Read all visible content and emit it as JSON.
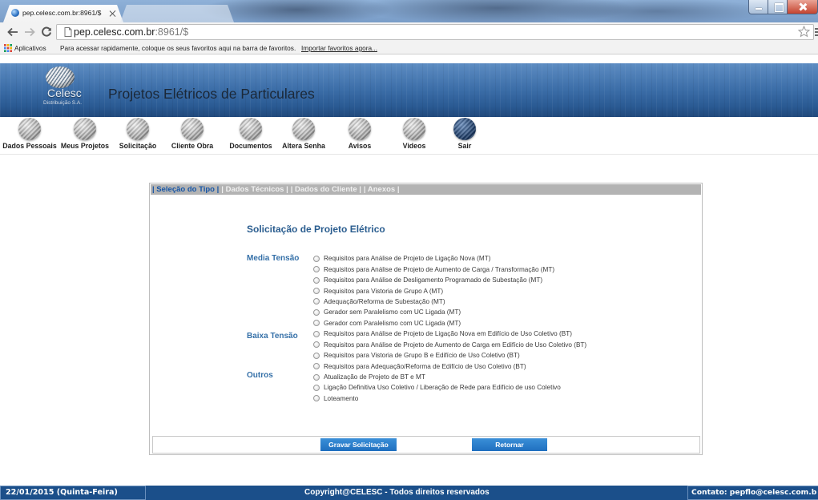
{
  "browser": {
    "active_tab": {
      "title": "pep.celesc.com.br:8961/$"
    },
    "address_bar": {
      "host": "pep.celesc.com.br",
      "rest": ":8961/$"
    },
    "bookmarks_bar": {
      "apps_label": "Aplicativos",
      "hint": "Para acessar rapidamente, coloque os seus favoritos aqui na barra de favoritos.",
      "import_link": "Importar favoritos agora..."
    },
    "icons": [
      "tab-close-icon",
      "minimize-icon",
      "maximize-icon",
      "window-close-icon",
      "back-arrow-icon",
      "forward-arrow-icon",
      "reload-icon",
      "page-icon",
      "star-icon",
      "menu-icon",
      "apps-grid-icon"
    ]
  },
  "header": {
    "logo_name": "Celesc",
    "logo_sub": "Distribuição S.A.",
    "title": "Projetos Elétricos de Particulares"
  },
  "nav": {
    "items": [
      {
        "label": "Dados Pessoais",
        "icon": "globe-icon"
      },
      {
        "label": "Meus Projetos",
        "icon": "globe-icon"
      },
      {
        "label": "Solicitação",
        "icon": "globe-icon"
      },
      {
        "label": "Cliente Obra",
        "icon": "globe-icon"
      },
      {
        "label": "Documentos",
        "icon": "globe-icon"
      },
      {
        "label": "Altera Senha",
        "icon": "globe-icon"
      },
      {
        "label": "Avisos",
        "icon": "globe-icon"
      },
      {
        "label": "Videos",
        "icon": "globe-icon"
      },
      {
        "label": "Sair",
        "icon": "globe-icon-dark"
      }
    ]
  },
  "form": {
    "tabs": [
      {
        "label": "| Seleção do Tipo |",
        "active": true
      },
      {
        "label": "| Dados Técnicos |",
        "active": false
      },
      {
        "label": "| Dados do Cliente |",
        "active": false
      },
      {
        "label": "| Anexos |",
        "active": false
      }
    ],
    "heading": "Solicitação de Projeto Elétrico",
    "groups": {
      "media_tensao": "Media Tensão",
      "baixa_tensao": "Baixa Tensão",
      "outros": "Outros"
    },
    "options": [
      "Requisitos para Análise de Projeto de Ligação Nova (MT)",
      "Requisitos para Análise de Projeto de Aumento de Carga / Transformação (MT)",
      "Requisitos para Análise de Desligamento Programado de Subestação (MT)",
      "Requisitos para Vistoria de Grupo A (MT)",
      "Adequação/Reforma de Subestação (MT)",
      "Gerador sem Paralelismo com UC Ligada (MT)",
      "Gerador com Paralelismo com UC Ligada (MT)",
      "Requisitos para Análise de Projeto de Ligação Nova em Edifício de Uso Coletivo (BT)",
      "Requisitos para Análise de Projeto de Aumento de Carga em Edifício de Uso Coletivo (BT)",
      "Requisitos para Vistoria de Grupo B e Edifício de Uso Coletivo (BT)",
      "Requisitos para Adequação/Reforma de Edifício de Uso Coletivo (BT)",
      "Atualização de Projeto de BT e MT",
      "Ligação Definitiva Uso Coletivo / Liberação de Rede para Edifício de uso Coletivo",
      "Loteamento"
    ],
    "buttons": {
      "submit": "Gravar Solicitação",
      "back": "Retornar"
    }
  },
  "footer": {
    "date": "22/01/2015 (Quinta-Feira)",
    "copyright": "Copyright@CELESC - Todos direitos reservados",
    "contact": "Contato: pepflo@celesc.com.b"
  },
  "colors": {
    "banner_blue": "#3e70aa",
    "heading_blue": "#2a5d8f",
    "group_blue": "#3570a8",
    "button_blue": "#2b7ec6",
    "footer_blue": "#1b4f8a",
    "tab_bar_gray": "#b3b3b3"
  }
}
